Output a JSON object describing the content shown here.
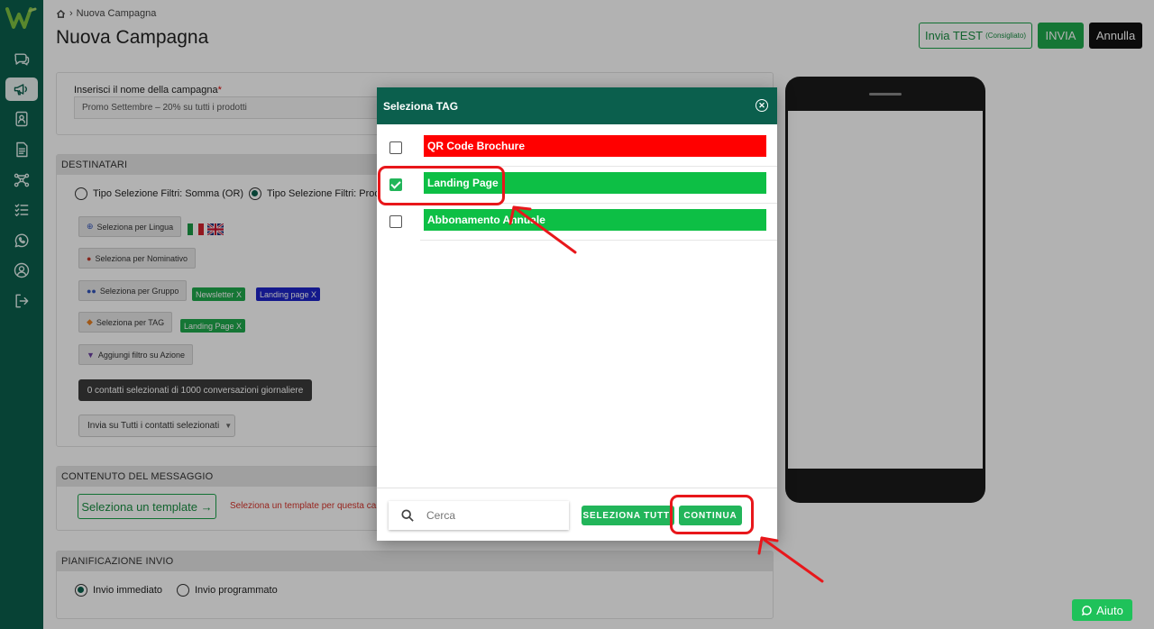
{
  "header": {
    "breadcrumb": "Nuova Campagna",
    "title": "Nuova Campagna",
    "btn_test_label": "Invia TEST",
    "btn_test_note": "(Consigliato)",
    "btn_send_label": "INVIA",
    "btn_cancel_label": "Annulla"
  },
  "form": {
    "name_label": "Inserisci il nome della campagna",
    "name_required_mark": "*",
    "name_value": "Promo Settembre – 20% su tutti i prodotti",
    "recipients_title": "DESTINATARI",
    "radio_or_label": "Tipo Selezione Filtri: Somma (OR)",
    "radio_and_label": "Tipo Selezione Filtri: Prodo",
    "btn_lingua": "Seleziona per Lingua",
    "btn_nominativo": "Seleziona per Nominativo",
    "btn_gruppo": "Seleziona per Gruppo",
    "chip_newsletter": "Newsletter X",
    "chip_landing_group": "Landing page X",
    "btn_tag": "Seleziona per TAG",
    "chip_landing_tag": "Landing Page  X",
    "btn_azione": "Aggiungi filtro su Azione",
    "contacts_count": "0 contatti selezionati di 1000 conversazioni giornaliere",
    "send_select": "Invia su Tutti i contatti selezionati",
    "message_title": "CONTENUTO DEL MESSAGGIO",
    "template_button": "Seleziona un template →",
    "template_hint": "Seleziona un template per questa cam",
    "schedule_title": "PIANIFICAZIONE INVIO",
    "radio_immediate": "Invio immediato",
    "radio_scheduled": "Invio programmato"
  },
  "modal": {
    "title": "Seleziona TAG",
    "tags": [
      {
        "label": "QR Code Brochure",
        "color": "#ff0000",
        "checked": false
      },
      {
        "label": "Landing Page",
        "color": "#0dbf45",
        "checked": true
      },
      {
        "label": "Abbonamento Annuale",
        "color": "#0dbf45",
        "checked": false
      }
    ],
    "search_placeholder": "Cerca",
    "select_all_label": "SELEZIONA TUTTI",
    "continue_label": "CONTINUA"
  },
  "help_label": "Aiuto",
  "colors": {
    "sidebar": "#0b5f4d",
    "accent_green": "#1fa94c",
    "annotation_red": "#e8171b"
  }
}
